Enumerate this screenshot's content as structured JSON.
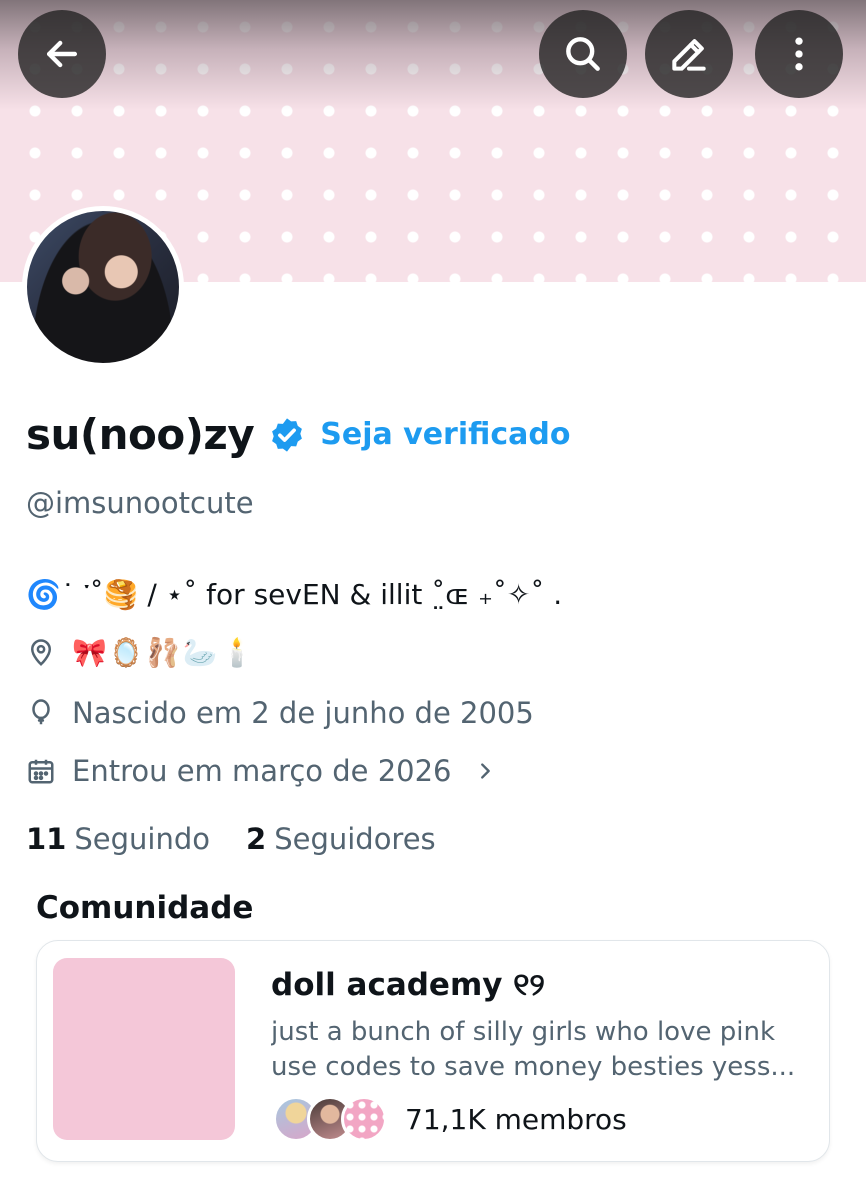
{
  "header": {
    "back_label": "Voltar",
    "search_label": "Pesquisar",
    "edit_label": "Editar",
    "more_label": "Mais opções"
  },
  "profile": {
    "display_name": "su(noo)zy",
    "verify_prompt": "Seja verificado",
    "handle": "@imsunootcute",
    "bio": "🌀˙ ་˚🥞 ∕ ⋆˚ for sevEN & illit ˚̤ɶ ₊˚✧˚ .",
    "location": "🎀🪞🩰🦢🕯️",
    "birth": "Nascido em 2 de junho de 2005",
    "joined": "Entrou em março de 2026"
  },
  "stats": {
    "following_count": "11",
    "following_label": "Seguindo",
    "followers_count": "2",
    "followers_label": "Seguidores"
  },
  "community": {
    "heading": "Comunidade",
    "name": "doll academy ୧୨",
    "desc_line1": "just a bunch of silly girls who love pink",
    "desc_line2": "use codes to save money besties yess...",
    "members": "71,1K membros"
  },
  "colors": {
    "accent": "#1d9bf0",
    "banner": "#f7e1e8",
    "community_thumb": "#f4c7d8",
    "secondary_text": "#536471"
  },
  "icons": [
    "back-arrow-icon",
    "search-icon",
    "pencil-icon",
    "more-vertical-icon",
    "verified-badge-icon",
    "location-pin-icon",
    "balloon-icon",
    "calendar-icon",
    "chevron-right-icon"
  ]
}
